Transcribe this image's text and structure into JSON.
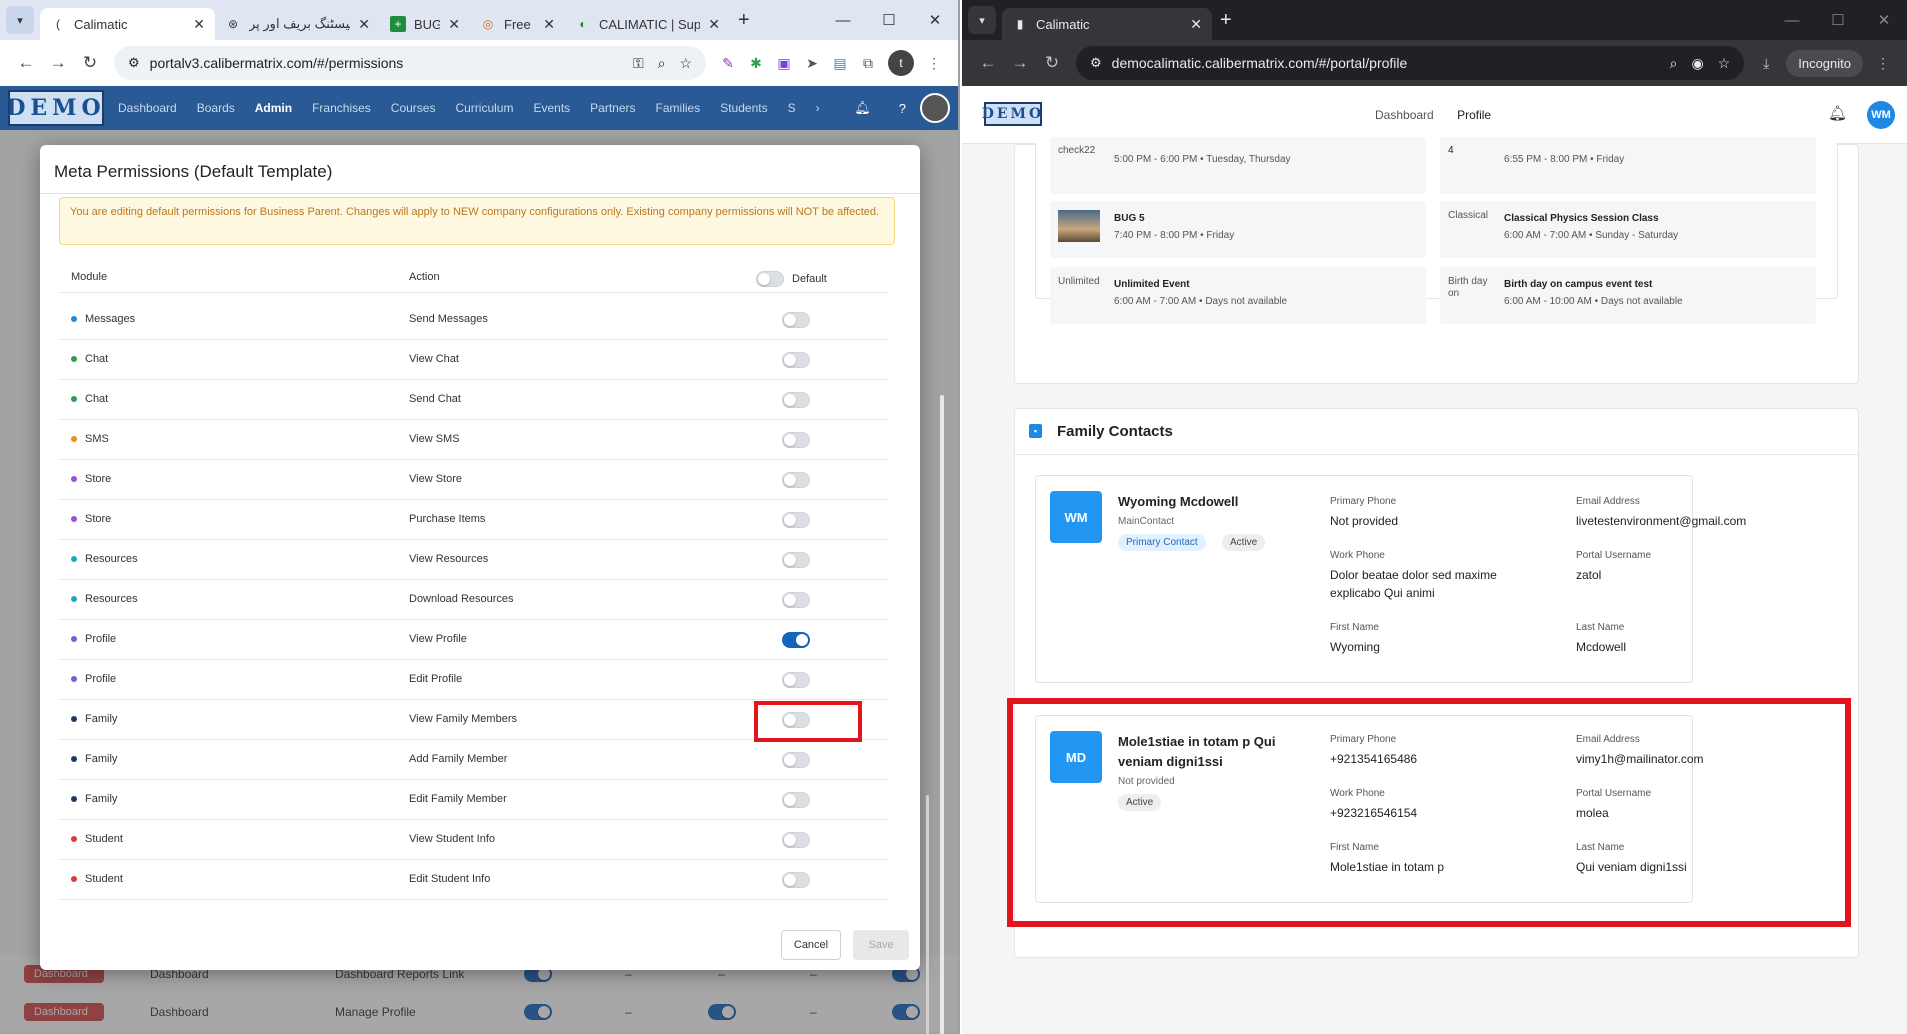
{
  "left_browser": {
    "tabs": [
      {
        "label": "Calimatic",
        "active": true
      },
      {
        "label": "ٹیسٹنگ بریف اور پر",
        "active": false
      },
      {
        "label": "BUG",
        "active": false
      },
      {
        "label": "Free",
        "active": false
      },
      {
        "label": "CALIMATIC | Super",
        "active": false
      }
    ],
    "url": "portalv3.calibermatrix.com/#/permissions",
    "profile_initial": "t"
  },
  "left_app": {
    "logo": "DEMO",
    "nav": [
      "Dashboard",
      "Boards",
      "Admin",
      "Franchises",
      "Courses",
      "Curriculum",
      "Events",
      "Partners",
      "Families",
      "Students",
      "S"
    ],
    "active_nav": "Admin",
    "bg_rows": [
      {
        "badge": "Dashboard",
        "module": "Dashboard",
        "action": "Dashboard Reports Link",
        "dash1": "–",
        "dash2": "–",
        "dash3": "–"
      },
      {
        "badge": "Dashboard",
        "module": "Dashboard",
        "action": "Manage Profile",
        "dash1": "–",
        "dash2": "–"
      }
    ]
  },
  "modal": {
    "title": "Meta Permissions (Default Template)",
    "warning": "You are editing default permissions for Business Parent. Changes will apply to NEW company configurations only. Existing company permissions will NOT be affected.",
    "col_module": "Module",
    "col_action": "Action",
    "col_default": "Default",
    "rows": [
      {
        "module": "Messages",
        "action": "Send Messages",
        "dot": "#1e88e5",
        "on": false
      },
      {
        "module": "Chat",
        "action": "View Chat",
        "dot": "#2e9e4f",
        "on": false
      },
      {
        "module": "Chat",
        "action": "Send Chat",
        "dot": "#2e9e4f",
        "on": false
      },
      {
        "module": "SMS",
        "action": "View SMS",
        "dot": "#f08c1a",
        "on": false
      },
      {
        "module": "Store",
        "action": "View Store",
        "dot": "#9c4fd6",
        "on": false
      },
      {
        "module": "Store",
        "action": "Purchase Items",
        "dot": "#9c4fd6",
        "on": false
      },
      {
        "module": "Resources",
        "action": "View Resources",
        "dot": "#1ba8c4",
        "on": false
      },
      {
        "module": "Resources",
        "action": "Download Resources",
        "dot": "#1ba8c4",
        "on": false
      },
      {
        "module": "Profile",
        "action": "View Profile",
        "dot": "#7b5bd6",
        "on": true
      },
      {
        "module": "Profile",
        "action": "Edit Profile",
        "dot": "#7b5bd6",
        "on": false
      },
      {
        "module": "Family",
        "action": "View Family Members",
        "dot": "#1f3a66",
        "on": false
      },
      {
        "module": "Family",
        "action": "Add Family Member",
        "dot": "#1f3a66",
        "on": false
      },
      {
        "module": "Family",
        "action": "Edit Family Member",
        "dot": "#1f3a66",
        "on": false
      },
      {
        "module": "Student",
        "action": "View Student Info",
        "dot": "#d63a3a",
        "on": false
      },
      {
        "module": "Student",
        "action": "Edit Student Info",
        "dot": "#d63a3a",
        "on": false
      }
    ],
    "cancel": "Cancel",
    "save": "Save"
  },
  "right_browser": {
    "tab": "Calimatic",
    "url": "democalimatic.calibermatrix.com/#/portal/profile",
    "incognito": "Incognito"
  },
  "right_app": {
    "logo": "DEMO",
    "nav": [
      "Dashboard",
      "Profile"
    ],
    "avatar": "WM",
    "events": [
      {
        "title": "check22",
        "time": "5:00 PM - 6:00 PM • Tuesday, Thursday",
        "thumb": ""
      },
      {
        "title": "4",
        "time": "6:55 PM - 8:00 PM • Friday",
        "thumb": ""
      },
      {
        "title": "BUG 5",
        "time": "7:40 PM - 8:00 PM • Friday",
        "thumb": ""
      },
      {
        "title": "Classical Physics Session Class",
        "time": "6:00 AM - 7:00 AM • Sunday - Saturday",
        "thumb": "Classical"
      },
      {
        "title": "Unlimited Event",
        "time": "6:00 AM - 7:00 AM • Days not available",
        "thumb": "Unlimited"
      },
      {
        "title": "Birth day on campus event test",
        "time": "6:00 AM - 10:00 AM • Days not available",
        "thumb": "Birth day on"
      }
    ],
    "family_title": "Family Contacts",
    "contacts": [
      {
        "initials": "WM",
        "name": "Wyoming Mcdowell",
        "sub": "MainContact",
        "badges": [
          "Primary Contact",
          "Active"
        ],
        "primary_phone_label": "Primary Phone",
        "primary_phone": "Not provided",
        "email_label": "Email Address",
        "email": "livetestenvironment@gmail.com",
        "work_phone_label": "Work Phone",
        "work_phone": "Dolor beatae dolor sed maxime explicabo Qui animi",
        "username_label": "Portal Username",
        "username": "zatol",
        "first_label": "First Name",
        "first": "Wyoming",
        "last_label": "Last Name",
        "last": "Mcdowell"
      },
      {
        "initials": "MD",
        "name": "Mole1stiae in totam p Qui veniam digni1ssi",
        "sub": "Not provided",
        "badges": [
          "Active"
        ],
        "primary_phone_label": "Primary Phone",
        "primary_phone": "+921354165486",
        "email_label": "Email Address",
        "email": "vimy1h@mailinator.com",
        "work_phone_label": "Work Phone",
        "work_phone": "+923216546154",
        "username_label": "Portal Username",
        "username": "molea",
        "first_label": "First Name",
        "first": "Mole1stiae in totam p",
        "last_label": "Last Name",
        "last": "Qui veniam digni1ssi"
      }
    ]
  }
}
